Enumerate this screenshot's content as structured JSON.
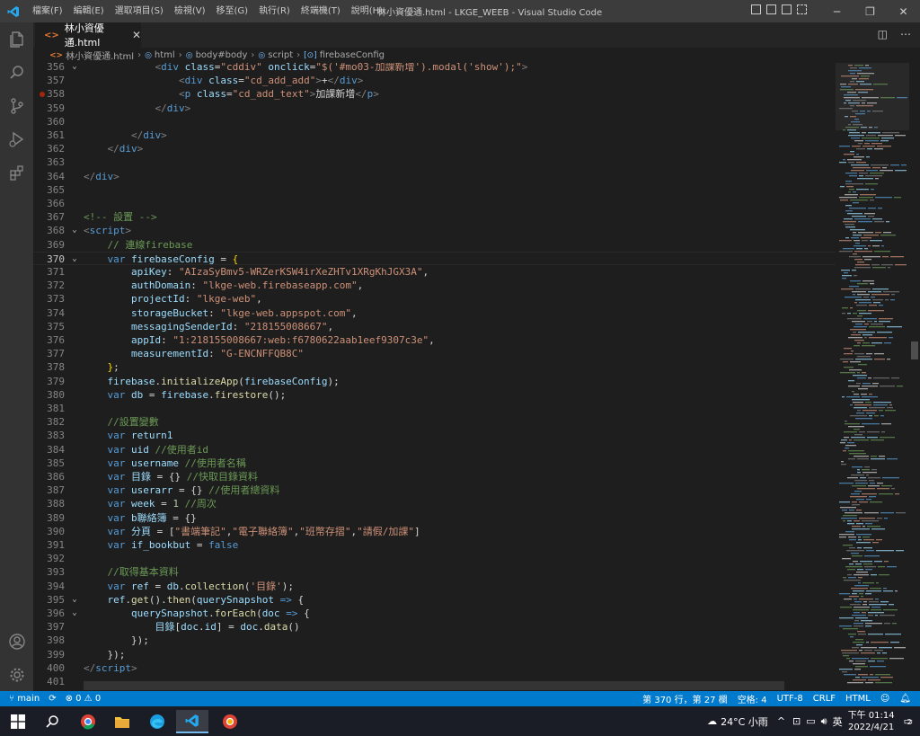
{
  "titlebar": {
    "menus": [
      "檔案(F)",
      "編輯(E)",
      "選取項目(S)",
      "檢視(V)",
      "移至(G)",
      "執行(R)",
      "終端機(T)",
      "說明(H)"
    ],
    "window_title": "林小資優通.html - LKGE_WEEB - Visual Studio Code"
  },
  "tab": {
    "filename": "林小資優通.html",
    "icon_text": "<>",
    "close": "✕"
  },
  "breadcrumb": [
    "林小資優通.html",
    "html",
    "body#body",
    "script",
    "firebaseConfig"
  ],
  "editor": {
    "lines": [
      {
        "n": "356",
        "fold": "⌄",
        "html": "<span class='t-br'>            &lt;</span><span class='t-tag'>div</span> <span class='t-attr'>class</span><span class='t-txt'>=</span><span class='t-str'>\"cddiv\"</span> <span class='t-attr'>onclick</span><span class='t-txt'>=</span><span class='t-str'>\"$('#mo03-加課新增').modal('show');\"</span><span class='t-br'>&gt;</span>"
      },
      {
        "n": "357",
        "html": "<span class='t-br'>                &lt;</span><span class='t-tag'>div</span> <span class='t-attr'>class</span><span class='t-txt'>=</span><span class='t-str'>\"cd_add_add\"</span><span class='t-br'>&gt;</span><span class='t-txt'>+</span><span class='t-br'>&lt;/</span><span class='t-tag'>div</span><span class='t-br'>&gt;</span>"
      },
      {
        "n": "358",
        "bp": true,
        "html": "<span class='t-br'>                &lt;</span><span class='t-tag'>p</span> <span class='t-attr'>class</span><span class='t-txt'>=</span><span class='t-str'>\"cd_add_text\"</span><span class='t-br'>&gt;</span><span class='t-txt'>加課新增</span><span class='t-br'>&lt;/</span><span class='t-tag'>p</span><span class='t-br'>&gt;</span>"
      },
      {
        "n": "359",
        "html": "<span class='t-br'>            &lt;/</span><span class='t-tag'>div</span><span class='t-br'>&gt;</span>"
      },
      {
        "n": "360",
        "html": ""
      },
      {
        "n": "361",
        "html": "<span class='t-br'>        &lt;/</span><span class='t-tag'>div</span><span class='t-br'>&gt;</span>"
      },
      {
        "n": "362",
        "html": "<span class='t-br'>    &lt;/</span><span class='t-tag'>div</span><span class='t-br'>&gt;</span>"
      },
      {
        "n": "363",
        "html": ""
      },
      {
        "n": "364",
        "html": "<span class='t-br'>&lt;/</span><span class='t-tag'>div</span><span class='t-br'>&gt;</span>"
      },
      {
        "n": "365",
        "html": ""
      },
      {
        "n": "366",
        "html": ""
      },
      {
        "n": "367",
        "html": "<span class='t-com'>&lt;!-- 設置 --&gt;</span>"
      },
      {
        "n": "368",
        "fold": "⌄",
        "html": "<span class='t-br'>&lt;</span><span class='t-tag'>script</span><span class='t-br'>&gt;</span>"
      },
      {
        "n": "369",
        "html": "<span class='t-com'>    // 連線firebase</span>"
      },
      {
        "n": "370",
        "fold": "⌄",
        "current": true,
        "html": "<span class='t-kw'>    var</span> <span class='t-var'>firebaseConfig</span> <span class='t-txt'>=</span> <span class='t-par'>{</span>"
      },
      {
        "n": "371",
        "html": "<span class='t-var'>        apiKey</span><span class='t-txt'>: </span><span class='t-str'>\"AIzaSyBmv5-WRZerKSW4irXeZHTv1XRgKhJGX3A\"</span><span class='t-txt'>,</span>"
      },
      {
        "n": "372",
        "html": "<span class='t-var'>        authDomain</span><span class='t-txt'>: </span><span class='t-str'>\"lkge-web.firebaseapp.com\"</span><span class='t-txt'>,</span>"
      },
      {
        "n": "373",
        "html": "<span class='t-var'>        projectId</span><span class='t-txt'>: </span><span class='t-str'>\"lkge-web\"</span><span class='t-txt'>,</span>"
      },
      {
        "n": "374",
        "html": "<span class='t-var'>        storageBucket</span><span class='t-txt'>: </span><span class='t-str'>\"lkge-web.appspot.com\"</span><span class='t-txt'>,</span>"
      },
      {
        "n": "375",
        "html": "<span class='t-var'>        messagingSenderId</span><span class='t-txt'>: </span><span class='t-str'>\"218155008667\"</span><span class='t-txt'>,</span>"
      },
      {
        "n": "376",
        "html": "<span class='t-var'>        appId</span><span class='t-txt'>: </span><span class='t-str'>\"1:218155008667:web:f6780622aab1eef9307c3e\"</span><span class='t-txt'>,</span>"
      },
      {
        "n": "377",
        "html": "<span class='t-var'>        measurementId</span><span class='t-txt'>: </span><span class='t-str'>\"G-ENCNFFQB8C\"</span>"
      },
      {
        "n": "378",
        "html": "<span class='t-par'>    }</span><span class='t-txt'>;</span>"
      },
      {
        "n": "379",
        "html": "<span class='t-var'>    firebase</span><span class='t-txt'>.</span><span class='t-fn'>initializeApp</span><span class='t-txt'>(</span><span class='t-var'>firebaseConfig</span><span class='t-txt'>);</span>"
      },
      {
        "n": "380",
        "html": "<span class='t-kw'>    var</span> <span class='t-var'>db</span> <span class='t-txt'>= </span><span class='t-var'>firebase</span><span class='t-txt'>.</span><span class='t-fn'>firestore</span><span class='t-txt'>();</span>"
      },
      {
        "n": "381",
        "html": ""
      },
      {
        "n": "382",
        "html": "<span class='t-com'>    //設置變數</span>"
      },
      {
        "n": "383",
        "html": "<span class='t-kw'>    var</span> <span class='t-var'>return1</span>"
      },
      {
        "n": "384",
        "html": "<span class='t-kw'>    var</span> <span class='t-var'>uid</span> <span class='t-com'>//使用者id</span>"
      },
      {
        "n": "385",
        "html": "<span class='t-kw'>    var</span> <span class='t-var'>username</span> <span class='t-com'>//使用者名稱</span>"
      },
      {
        "n": "386",
        "html": "<span class='t-kw'>    var</span> <span class='t-var'>目錄</span> <span class='t-txt'>= {}</span> <span class='t-com'>//快取目錄資料</span>"
      },
      {
        "n": "387",
        "html": "<span class='t-kw'>    var</span> <span class='t-var'>userarr</span> <span class='t-txt'>= {}</span> <span class='t-com'>//使用者總資料</span>"
      },
      {
        "n": "388",
        "html": "<span class='t-kw'>    var</span> <span class='t-var'>week</span> <span class='t-txt'>= </span><span class='t-num'>1</span> <span class='t-com'>//周次</span>"
      },
      {
        "n": "389",
        "html": "<span class='t-kw'>    var</span> <span class='t-var'>b聯絡簿</span> <span class='t-txt'>= {}</span>"
      },
      {
        "n": "390",
        "html": "<span class='t-kw'>    var</span> <span class='t-var'>分頁</span> <span class='t-txt'>= [</span><span class='t-str'>\"書端筆記\"</span><span class='t-txt'>,</span><span class='t-str'>\"電子聯絡簿\"</span><span class='t-txt'>,</span><span class='t-str'>\"班幣存摺\"</span><span class='t-txt'>,</span><span class='t-str'>\"請假/加課\"</span><span class='t-txt'>]</span>"
      },
      {
        "n": "391",
        "html": "<span class='t-kw'>    var</span> <span class='t-var'>if_bookbut</span> <span class='t-txt'>= </span><span class='t-kw'>false</span>"
      },
      {
        "n": "392",
        "html": ""
      },
      {
        "n": "393",
        "html": "<span class='t-com'>    //取得基本資料</span>"
      },
      {
        "n": "394",
        "html": "<span class='t-kw'>    var</span> <span class='t-var'>ref</span> <span class='t-txt'>= </span><span class='t-var'>db</span><span class='t-txt'>.</span><span class='t-fn'>collection</span><span class='t-txt'>(</span><span class='t-str'>'目錄'</span><span class='t-txt'>);</span>"
      },
      {
        "n": "395",
        "fold": "⌄",
        "html": "<span class='t-var'>    ref</span><span class='t-txt'>.</span><span class='t-fn'>get</span><span class='t-txt'>().</span><span class='t-fn'>then</span><span class='t-txt'>(</span><span class='t-var'>querySnapshot</span> <span class='t-kw'>=&gt;</span> <span class='t-txt'>{</span>"
      },
      {
        "n": "396",
        "fold": "⌄",
        "html": "<span class='t-var'>        querySnapshot</span><span class='t-txt'>.</span><span class='t-fn'>forEach</span><span class='t-txt'>(</span><span class='t-var'>doc</span> <span class='t-kw'>=&gt;</span> <span class='t-txt'>{</span>"
      },
      {
        "n": "397",
        "html": "<span class='t-var'>            目錄</span><span class='t-txt'>[</span><span class='t-var'>doc</span><span class='t-txt'>.</span><span class='t-var'>id</span><span class='t-txt'>] = </span><span class='t-var'>doc</span><span class='t-txt'>.</span><span class='t-fn'>data</span><span class='t-txt'>()</span>"
      },
      {
        "n": "398",
        "html": "<span class='t-txt'>        });</span>"
      },
      {
        "n": "399",
        "html": "<span class='t-txt'>    });</span>"
      },
      {
        "n": "400",
        "html": "<span class='t-br'>&lt;/</span><span class='t-tag'>script</span><span class='t-br'>&gt;</span>"
      },
      {
        "n": "401",
        "html": ""
      }
    ]
  },
  "statusbar": {
    "branch": "main",
    "sync": "⟳",
    "problems": "⊗ 0 ⚠ 0",
    "cursor": "第 370 行，第 27 欄",
    "indent": "空格: 4",
    "encoding": "UTF-8",
    "eol": "CRLF",
    "language": "HTML"
  },
  "taskbar": {
    "weather": "24°C 小雨",
    "ime": "英",
    "time": "下午 01:14",
    "date": "2022/4/21",
    "notifications": "2"
  },
  "colors": {
    "accent": "#007acc",
    "titlebar": "#3c3c3c",
    "editor_bg": "#1e1e1e"
  }
}
